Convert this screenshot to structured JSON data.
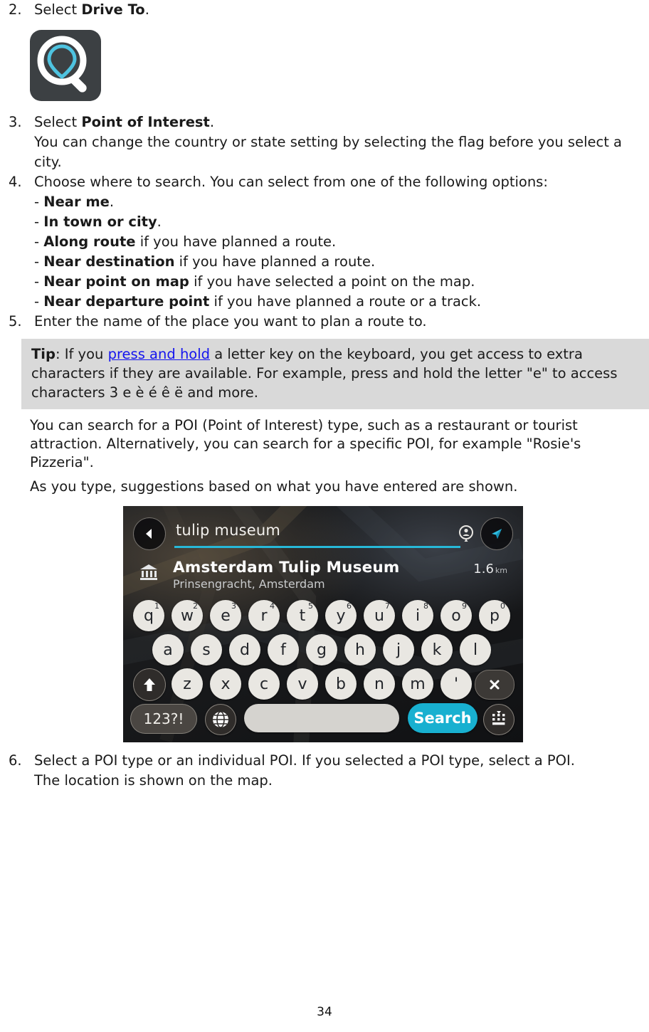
{
  "document": {
    "page_number": "34"
  },
  "steps": {
    "step2": {
      "number": "2.",
      "prefix": "Select ",
      "bold": "Drive To",
      "suffix": "."
    },
    "step3": {
      "number": "3.",
      "prefix": "Select ",
      "bold": "Point of Interest",
      "suffix": "."
    },
    "step3_note": "You can change the country or state setting by selecting the flag before you select a city.",
    "step4": {
      "number": "4.",
      "text": "Choose where to search. You can select from one of the following options:"
    },
    "step5": {
      "number": "5.",
      "text": "Enter the name of the place you want to plan a route to."
    },
    "step6": {
      "number": "6.",
      "text": "Select a POI type or an individual POI. If you selected a POI type, select a POI."
    },
    "step6_note": "The location is shown on the map."
  },
  "options": [
    {
      "dash": "- ",
      "bold": "Near me",
      "rest": "."
    },
    {
      "dash": "- ",
      "bold": "In town or city",
      "rest": "."
    },
    {
      "dash": "- ",
      "bold": "Along route",
      "rest": " if you have planned a route."
    },
    {
      "dash": "- ",
      "bold": "Near destination",
      "rest": " if you have planned a route."
    },
    {
      "dash": "- ",
      "bold": "Near point on map",
      "rest": " if you have selected a point on the map."
    },
    {
      "dash": "- ",
      "bold": "Near departure point",
      "rest": " if you have planned a route or a track."
    }
  ],
  "tip": {
    "label": "Tip",
    "colon": ": ",
    "before_link": "If you ",
    "link": "press and hold",
    "after_link": " a letter key on the keyboard, you get access to extra characters if they are available. For example, press and hold the letter \"e\" to access characters 3 e è é ê ë and more."
  },
  "paragraphs": {
    "poi_search": "You can search for a POI (Point of Interest) type, such as a restaurant or tourist attraction. Alternatively, you can search for a specific POI, for example \"Rosie's Pizzeria\".",
    "suggestions": "As you type, suggestions based on what you have entered are shown."
  },
  "device": {
    "search_value": "tulip museum",
    "suggestion": {
      "title": "Amsterdam Tulip Museum",
      "subtitle": "Prinsengracht, Amsterdam",
      "distance": "1.6",
      "distance_unit": "km"
    },
    "keyboard": {
      "row1": [
        {
          "key": "q",
          "sup": "1"
        },
        {
          "key": "w",
          "sup": "2"
        },
        {
          "key": "e",
          "sup": "3"
        },
        {
          "key": "r",
          "sup": "4"
        },
        {
          "key": "t",
          "sup": "5"
        },
        {
          "key": "y",
          "sup": "6"
        },
        {
          "key": "u",
          "sup": "7"
        },
        {
          "key": "i",
          "sup": "8"
        },
        {
          "key": "o",
          "sup": "9"
        },
        {
          "key": "p",
          "sup": "0"
        }
      ],
      "row2": [
        "a",
        "s",
        "d",
        "f",
        "g",
        "h",
        "j",
        "k",
        "l"
      ],
      "row3": [
        "z",
        "x",
        "c",
        "v",
        "b",
        "n",
        "m",
        "'"
      ],
      "numeric_key": "123?!",
      "search_key": "Search"
    }
  },
  "colors": {
    "accent_cyan": "#27b8d8",
    "search_button": "#18b0d0",
    "tip_background": "#d9d9d9",
    "link": "#1414ee",
    "icon_tile": "#3c4043"
  }
}
